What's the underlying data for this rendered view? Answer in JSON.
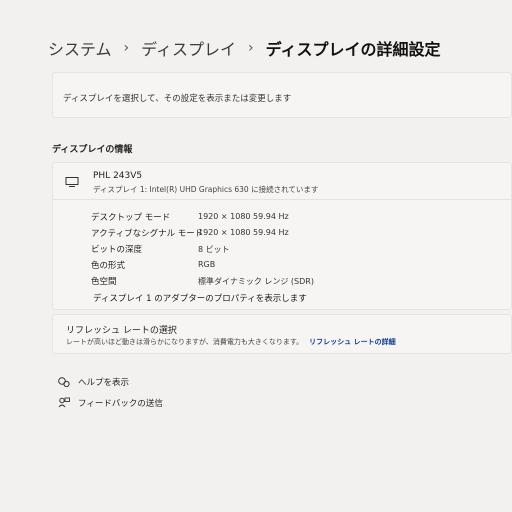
{
  "breadcrumb": {
    "items": [
      "システム",
      "ディスプレイ",
      "ディスプレイの詳細設定"
    ],
    "separator": "›"
  },
  "description": "ディスプレイを選択して、その設定を表示または変更します",
  "section_title": "ディスプレイの情報",
  "monitor": {
    "name": "PHL 243V5",
    "subtitle": "ディスプレイ 1: Intel(R) UHD Graphics 630 に接続されています",
    "icon": "monitor-icon"
  },
  "properties": [
    {
      "label": "デスクトップ モード",
      "value": "1920 × 1080 59.94 Hz"
    },
    {
      "label": "アクティブなシグナル モード",
      "value": "1920 × 1080 59.94 Hz"
    },
    {
      "label": "ビットの深度",
      "value": "8 ビット"
    },
    {
      "label": "色の形式",
      "value": "RGB"
    },
    {
      "label": "色空間",
      "value": "標準ダイナミック レンジ (SDR)"
    }
  ],
  "adapter_link": "ディスプレイ 1 のアダプターのプロパティを表示します",
  "refresh": {
    "title": "リフレッシュ レートの選択",
    "description": "レートが高いほど動きは滑らかになりますが、消費電力も大きくなります。",
    "link": "リフレッシュ レートの詳細"
  },
  "footer": {
    "help": "ヘルプを表示",
    "feedback": "フィードバックの送信"
  }
}
